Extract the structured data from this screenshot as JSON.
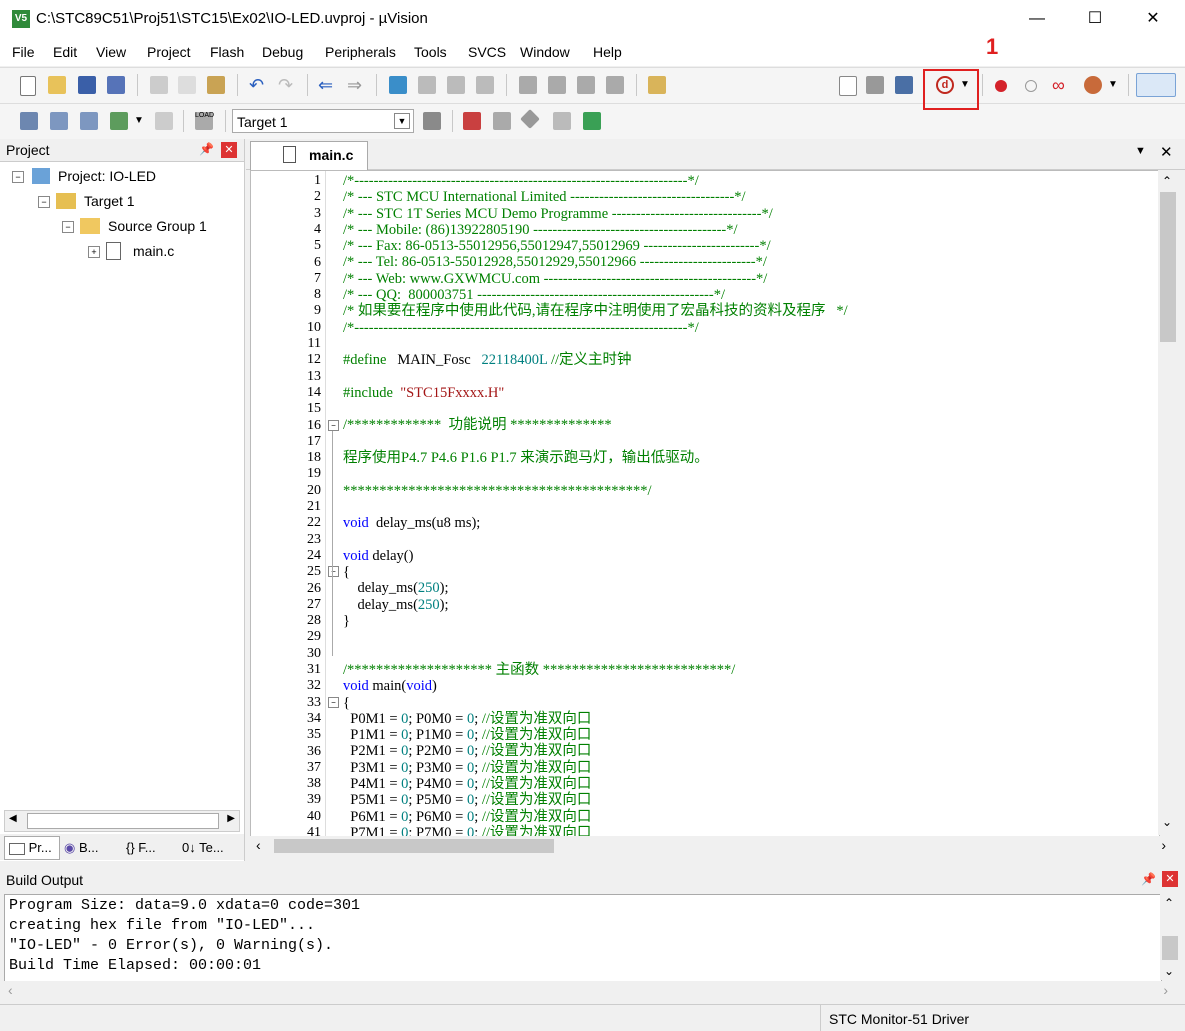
{
  "window": {
    "title": "C:\\STC89C51\\Proj51\\STC15\\Ex02\\IO-LED.uvproj - µVision",
    "icon": "V5"
  },
  "menu": [
    "File",
    "Edit",
    "View",
    "Project",
    "Flash",
    "Debug",
    "Peripherals",
    "Tools",
    "SVCS",
    "Window",
    "Help"
  ],
  "menu_mnemonics": [
    "F",
    "E",
    "V",
    "P",
    "a",
    "D",
    "P",
    "T",
    "S",
    "W",
    "H"
  ],
  "toolbar2": {
    "target": "Target 1"
  },
  "project": {
    "header": "Project",
    "root": "Project: IO-LED",
    "target": "Target 1",
    "group": "Source Group 1",
    "file": "main.c",
    "tabs": [
      "Pr...",
      "B...",
      "{} F...",
      "0↓ Te..."
    ]
  },
  "editor": {
    "tab": "main.c",
    "line_numbers": [
      "1",
      "2",
      "3",
      "4",
      "5",
      "6",
      "7",
      "8",
      "9",
      "10",
      "11",
      "12",
      "13",
      "14",
      "15",
      "16",
      "17",
      "18",
      "19",
      "20",
      "21",
      "22",
      "23",
      "24",
      "25",
      "26",
      "27",
      "28",
      "29",
      "30",
      "31",
      "32",
      "33",
      "34",
      "35",
      "36",
      "37",
      "38",
      "39",
      "40",
      "41"
    ]
  },
  "build": {
    "header": "Build Output",
    "lines": [
      "Program Size: data=9.0 xdata=0 code=301",
      "creating hex file from \"IO-LED\"...",
      "\"IO-LED\" - 0 Error(s), 0 Warning(s).",
      "Build Time Elapsed:  00:00:01"
    ]
  },
  "status": {
    "driver": "STC Monitor-51 Driver"
  },
  "annotation": {
    "label": "1",
    "color": "#e02020"
  }
}
